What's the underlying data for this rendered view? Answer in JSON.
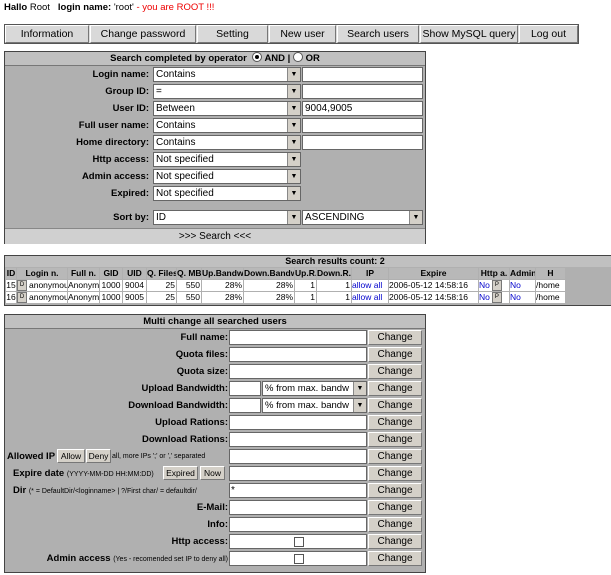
{
  "greeting": {
    "hello": "Hallo",
    "user": "Root",
    "login_label": "login name:",
    "login_value": "'root'",
    "warning": "- you are ROOT !!!"
  },
  "nav": [
    "Information",
    "Change password",
    "Setting",
    "New user",
    "Search users",
    "Show MySQL query",
    "Log out"
  ],
  "search": {
    "title": "Search completed by operator",
    "and_label": "AND",
    "separator": "|",
    "or_label": "OR",
    "selected_operator": "AND",
    "rows": [
      {
        "label": "Login name:",
        "op": "Contains",
        "value": ""
      },
      {
        "label": "Group ID:",
        "op": "=",
        "value": ""
      },
      {
        "label": "User ID:",
        "op": "Between",
        "value": "9004,9005"
      },
      {
        "label": "Full user name:",
        "op": "Contains",
        "value": ""
      },
      {
        "label": "Home directory:",
        "op": "Contains",
        "value": ""
      },
      {
        "label": "Http access:",
        "op": "Not specified"
      },
      {
        "label": "Admin access:",
        "op": "Not specified"
      },
      {
        "label": "Expired:",
        "op": "Not specified"
      }
    ],
    "sort_label": "Sort by:",
    "sort_field": "ID",
    "sort_order": "ASCENDING",
    "button": ">>> Search <<<"
  },
  "results": {
    "title": "Search results count: 2",
    "columns": [
      "ID",
      "Login n.",
      "Full n.",
      "GID",
      "UID",
      "Q. Files",
      "Q. MB",
      "Up.Bandw.",
      "Down.Bandw.",
      "Up.R.",
      "Down.R.",
      "IP",
      "Expire",
      "Http a.",
      "Admin",
      "H"
    ],
    "rows": [
      {
        "id": "15",
        "btn": "D",
        "login": "anonymous2",
        "full": "Anonymous",
        "gid": "1000",
        "uid": "9004",
        "qfiles": "25",
        "qmb": "550",
        "up": "28%",
        "down": "28%",
        "upr": "1",
        "downr": "1",
        "ip": "allow all",
        "expire": "2006-05-12 14:58:16",
        "http": "No",
        "http_btn": "P",
        "admin": "No",
        "home": "/home"
      },
      {
        "id": "16",
        "btn": "D",
        "login": "anonymous3",
        "full": "Anonymous",
        "gid": "1000",
        "uid": "9005",
        "qfiles": "25",
        "qmb": "550",
        "up": "28%",
        "down": "28%",
        "upr": "1",
        "downr": "1",
        "ip": "allow all",
        "expire": "2006-05-12 14:58:16",
        "http": "No",
        "http_btn": "P",
        "admin": "No",
        "home": "/home"
      }
    ]
  },
  "multi": {
    "title": "Multi change all searched users",
    "change_label": "Change",
    "full_name": "Full name:",
    "quota_files": "Quota files:",
    "quota_size": "Quota size:",
    "up_bw": "Upload Bandwidth:",
    "down_bw": "Download Bandwidth:",
    "bw_option": "% from max. bandw",
    "up_ratio": "Upload Rations:",
    "down_ratio": "Download Rations:",
    "allowed_ip": "Allowed IP",
    "allow_btn": "Allow",
    "deny_btn": "Deny",
    "ip_note": "all, more IPs ';' or ',' separated",
    "expire_label": "Expire date",
    "expire_note": "(YYYY-MM-DD HH:MM:DD)",
    "expired_btn": "Expired",
    "now_btn": "Now",
    "dir_label": "Dir",
    "dir_note": "(* = DefaultDir/<loginname> | ?/First char/ = defaultdir/",
    "dir_value": "*",
    "email": "E-Mail:",
    "info": "Info:",
    "http_access": "Http access:",
    "admin_access": "Admin access",
    "admin_note": "(Yes - recomended set IP to deny all)"
  }
}
